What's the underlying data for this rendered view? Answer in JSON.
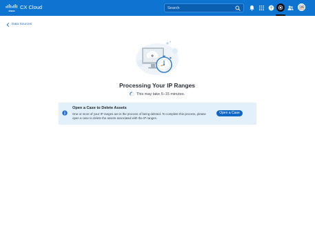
{
  "header": {
    "app_title": "CX Cloud",
    "search": {
      "placeholder": "Search",
      "value": ""
    },
    "icons": [
      "bell-icon",
      "apps-grid-icon",
      "help-icon",
      "settings-icon",
      "users-icon",
      "user-avatar"
    ],
    "accent_color": "#0d74d1"
  },
  "breadcrumb": {
    "label": "Data Sources"
  },
  "status": {
    "title": "Processing Your IP Ranges",
    "subtitle": "This may take 5–15 minutes."
  },
  "banner": {
    "title": "Open a Case to Delete Assets",
    "message": "One or more of your IP ranges are in the process of being deleted. To complete this process, please open a case to delete the assets associated with the IP ranges.",
    "button_label": "Open a Case",
    "background_color": "#e1f0fb"
  }
}
